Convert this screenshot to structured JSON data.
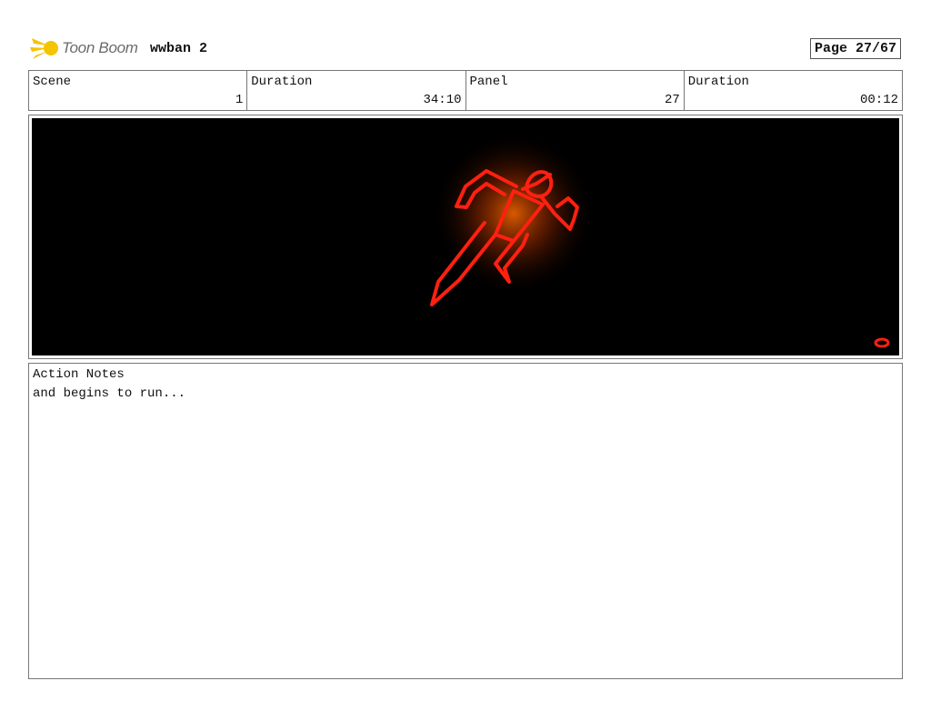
{
  "header": {
    "logo_text": "Toon Boom",
    "project_title": "wwban 2",
    "page_indicator": "Page 27/67"
  },
  "info": {
    "scene_label": "Scene",
    "scene_value": "1",
    "duration_label": "Duration",
    "duration_value": "34:10",
    "panel_label": "Panel",
    "panel_value": "27",
    "panel_duration_label": "Duration",
    "panel_duration_value": "00:12"
  },
  "panel": {
    "background_color": "#000000",
    "figure_color": "#ff2010",
    "glow_color": "#ff6a00"
  },
  "notes": {
    "label": "Action Notes",
    "text": "and begins to run..."
  },
  "colors": {
    "logo_accent": "#f5c400",
    "border": "#777777"
  }
}
